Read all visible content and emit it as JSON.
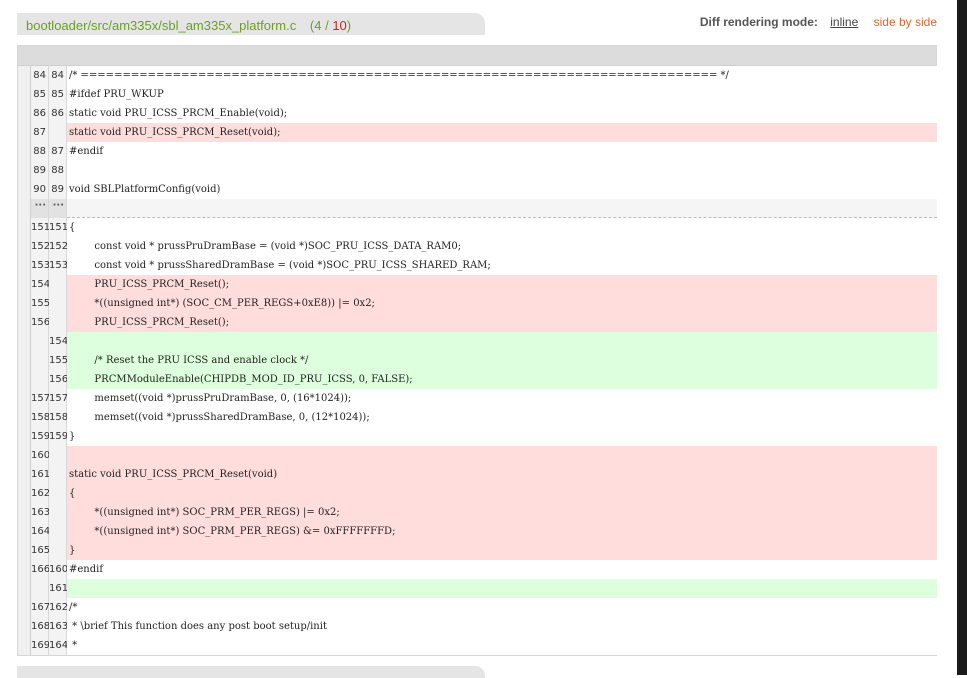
{
  "file": {
    "path": "bootloader/src/am335x/sbl_am335x_platform.c",
    "open_paren": "(",
    "current": "4",
    "slash": " / ",
    "total": "10",
    "close_paren": ")"
  },
  "mode": {
    "label": "Diff rendering mode:",
    "inline": "inline",
    "side_by_side": "side by side"
  },
  "lines": [
    {
      "type": "ctx",
      "old": "84",
      "new": "84",
      "text": "/* ============================================================================ */"
    },
    {
      "type": "ctx",
      "old": "85",
      "new": "85",
      "text": "#ifdef PRU_WKUP"
    },
    {
      "type": "ctx",
      "old": "86",
      "new": "86",
      "text": "static void PRU_ICSS_PRCM_Enable(void);"
    },
    {
      "type": "del",
      "old": "87",
      "new": "",
      "text": "static void PRU_ICSS_PRCM_Reset(void);"
    },
    {
      "type": "ctx",
      "old": "88",
      "new": "87",
      "text": "#endif"
    },
    {
      "type": "ctx",
      "old": "89",
      "new": "88",
      "text": ""
    },
    {
      "type": "ctx",
      "old": "90",
      "new": "89",
      "text": "void SBLPlatformConfig(void)"
    },
    {
      "type": "sep",
      "old": "···",
      "new": "···",
      "text": ""
    },
    {
      "type": "ctx",
      "old": "151",
      "new": "151",
      "text": "{"
    },
    {
      "type": "ctx",
      "old": "152",
      "new": "152",
      "text": "        const void * prussPruDramBase = (void *)SOC_PRU_ICSS_DATA_RAM0;"
    },
    {
      "type": "ctx",
      "old": "153",
      "new": "153",
      "text": "        const void * prussSharedDramBase = (void *)SOC_PRU_ICSS_SHARED_RAM;"
    },
    {
      "type": "del",
      "old": "154",
      "new": "",
      "text": "        PRU_ICSS_PRCM_Reset();"
    },
    {
      "type": "del",
      "old": "155",
      "new": "",
      "text": "        *((unsigned int*) (SOC_CM_PER_REGS+0xE8)) |= 0x2;"
    },
    {
      "type": "del",
      "old": "156",
      "new": "",
      "text": "        PRU_ICSS_PRCM_Reset();"
    },
    {
      "type": "add",
      "old": "",
      "new": "154",
      "text": ""
    },
    {
      "type": "add",
      "old": "",
      "new": "155",
      "text": "        /* Reset the PRU ICSS and enable clock */"
    },
    {
      "type": "add",
      "old": "",
      "new": "156",
      "text": "        PRCMModuleEnable(CHIPDB_MOD_ID_PRU_ICSS, 0, FALSE);"
    },
    {
      "type": "ctx",
      "old": "157",
      "new": "157",
      "text": "        memset((void *)prussPruDramBase, 0, (16*1024));"
    },
    {
      "type": "ctx",
      "old": "158",
      "new": "158",
      "text": "        memset((void *)prussSharedDramBase, 0, (12*1024));"
    },
    {
      "type": "ctx",
      "old": "159",
      "new": "159",
      "text": "}"
    },
    {
      "type": "del",
      "old": "160",
      "new": "",
      "text": ""
    },
    {
      "type": "del",
      "old": "161",
      "new": "",
      "text": "static void PRU_ICSS_PRCM_Reset(void)"
    },
    {
      "type": "del",
      "old": "162",
      "new": "",
      "text": "{"
    },
    {
      "type": "del",
      "old": "163",
      "new": "",
      "text": "        *((unsigned int*) SOC_PRM_PER_REGS) |= 0x2;"
    },
    {
      "type": "del",
      "old": "164",
      "new": "",
      "text": "        *((unsigned int*) SOC_PRM_PER_REGS) &= 0xFFFFFFFD;"
    },
    {
      "type": "del",
      "old": "165",
      "new": "",
      "text": "}"
    },
    {
      "type": "ctx",
      "old": "166",
      "new": "160",
      "text": "#endif"
    },
    {
      "type": "add",
      "old": "",
      "new": "161",
      "text": ""
    },
    {
      "type": "ctx",
      "old": "167",
      "new": "162",
      "text": "/*"
    },
    {
      "type": "ctx",
      "old": "168",
      "new": "163",
      "text": " * \\brief This function does any post boot setup/init"
    },
    {
      "type": "ctx",
      "old": "169",
      "new": "164",
      "text": " *"
    }
  ],
  "colors": {
    "deleted_bg": "#ffdddd",
    "added_bg": "#ddffdd",
    "path_green": "#6d9e25",
    "total_red": "#d11f1f",
    "side_by_side_orange": "#e0652d"
  }
}
